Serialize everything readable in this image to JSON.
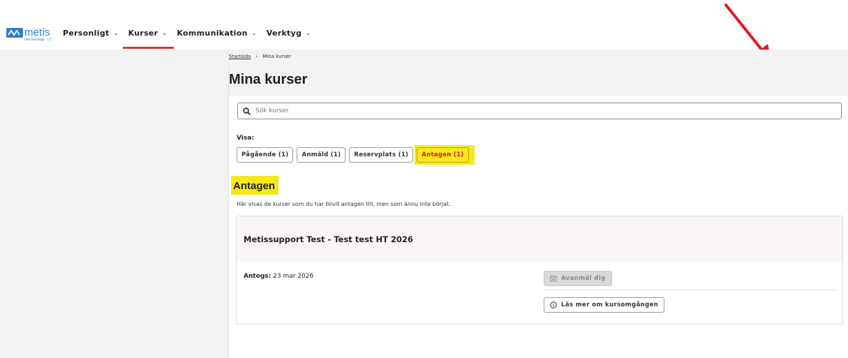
{
  "brand": {
    "name": "metis",
    "tagline": "mer kunskap · LT"
  },
  "nav": {
    "items": [
      {
        "label": "Personligt"
      },
      {
        "label": "Kurser"
      },
      {
        "label": "Kommunikation"
      },
      {
        "label": "Verktyg"
      }
    ],
    "active": "Kurser"
  },
  "breadcrumb": {
    "home": "Startsida",
    "separator": "›",
    "current": "Mina kurser"
  },
  "page": {
    "title": "Mina kurser"
  },
  "search": {
    "placeholder": "Sök kurser",
    "icon": "search-icon"
  },
  "filters": {
    "label": "Visa:",
    "items": [
      {
        "label": "Pågående (1)"
      },
      {
        "label": "Anmäld (1)"
      },
      {
        "label": "Reservplats (1)"
      },
      {
        "label": "Antagen (1)"
      }
    ],
    "active": "Antagen (1)"
  },
  "section": {
    "title": "Antagen",
    "description": "Här visas de kurser som du har blivit antagen till, men som ännu inte börjat."
  },
  "course": {
    "title": "Metissupport Test - Test test HT 2026",
    "admitted_label": "Antogs:",
    "admitted_date": "23 mar 2026",
    "unregister_label": "Avanmäl dig",
    "info_label": "Läs mer om kursomgången"
  },
  "colors": {
    "highlight": "#f5e81d",
    "active_nav_underline": "#d03a2c",
    "active_filter_text": "#d01f1f",
    "brand": "#2c7fd0",
    "annotation_arrow": "#e8161a"
  }
}
